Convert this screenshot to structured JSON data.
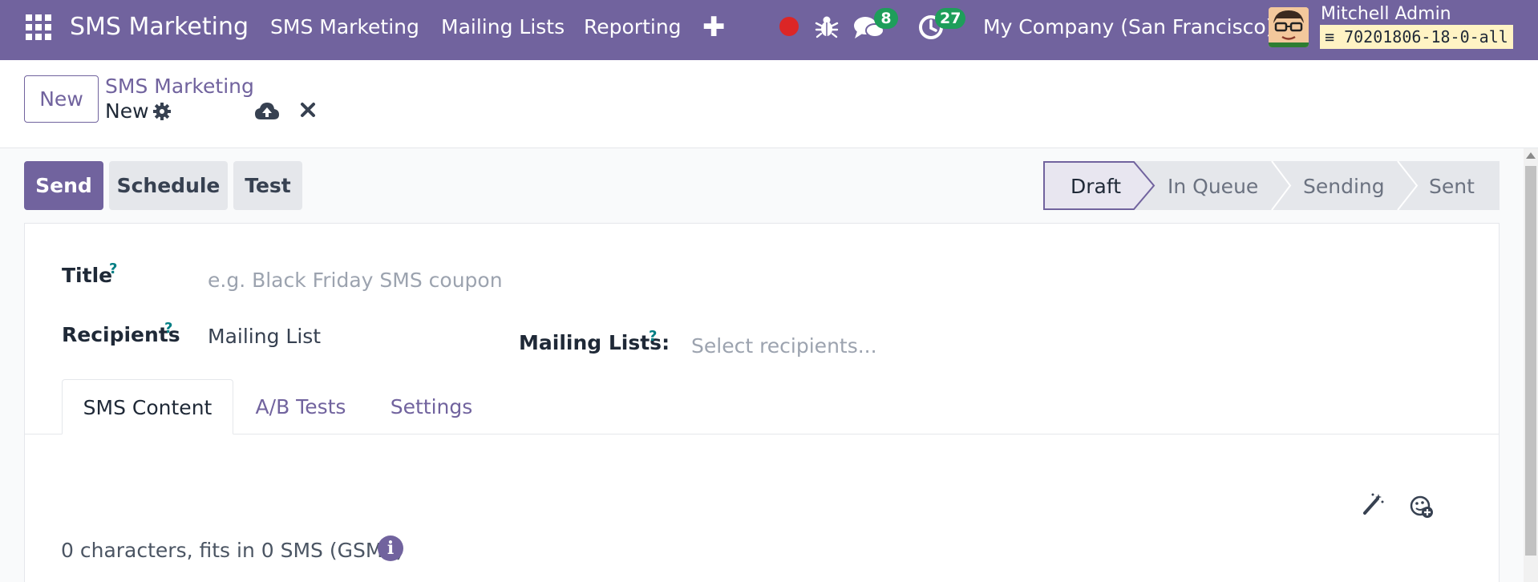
{
  "navbar": {
    "brand": "SMS Marketing",
    "menus": [
      "SMS Marketing",
      "Mailing Lists",
      "Reporting"
    ],
    "messages_count": "8",
    "activities_count": "27",
    "company": "My Company (San Francisco)",
    "user_name": "Mitchell Admin",
    "database": "70201806-18-0-all",
    "colors": {
      "bar": "#71639e",
      "badge": "#1e9e5a",
      "record": "#dc2626"
    }
  },
  "control_panel": {
    "new_label": "New",
    "breadcrumb_parent": "SMS Marketing",
    "breadcrumb_current": "New"
  },
  "actions": {
    "send_label": "Send",
    "schedule_label": "Schedule",
    "test_label": "Test"
  },
  "status_stages": [
    {
      "label": "Draft",
      "active": true
    },
    {
      "label": "In Queue",
      "active": false
    },
    {
      "label": "Sending",
      "active": false
    },
    {
      "label": "Sent",
      "active": false
    }
  ],
  "form": {
    "title_label": "Title",
    "title_placeholder": "e.g. Black Friday SMS coupon",
    "recipients_label": "Recipients",
    "recipients_value": "Mailing List",
    "mailing_lists_label": "Mailing Lists:",
    "mailing_lists_placeholder": "Select recipients...",
    "help_mark": "?"
  },
  "tabs": [
    {
      "label": "SMS Content",
      "active": true
    },
    {
      "label": "A/B Tests",
      "active": false
    },
    {
      "label": "Settings",
      "active": false
    }
  ],
  "sms": {
    "counter_text": "0 characters, fits in 0 SMS (GSM7)",
    "info_glyph": "i"
  }
}
